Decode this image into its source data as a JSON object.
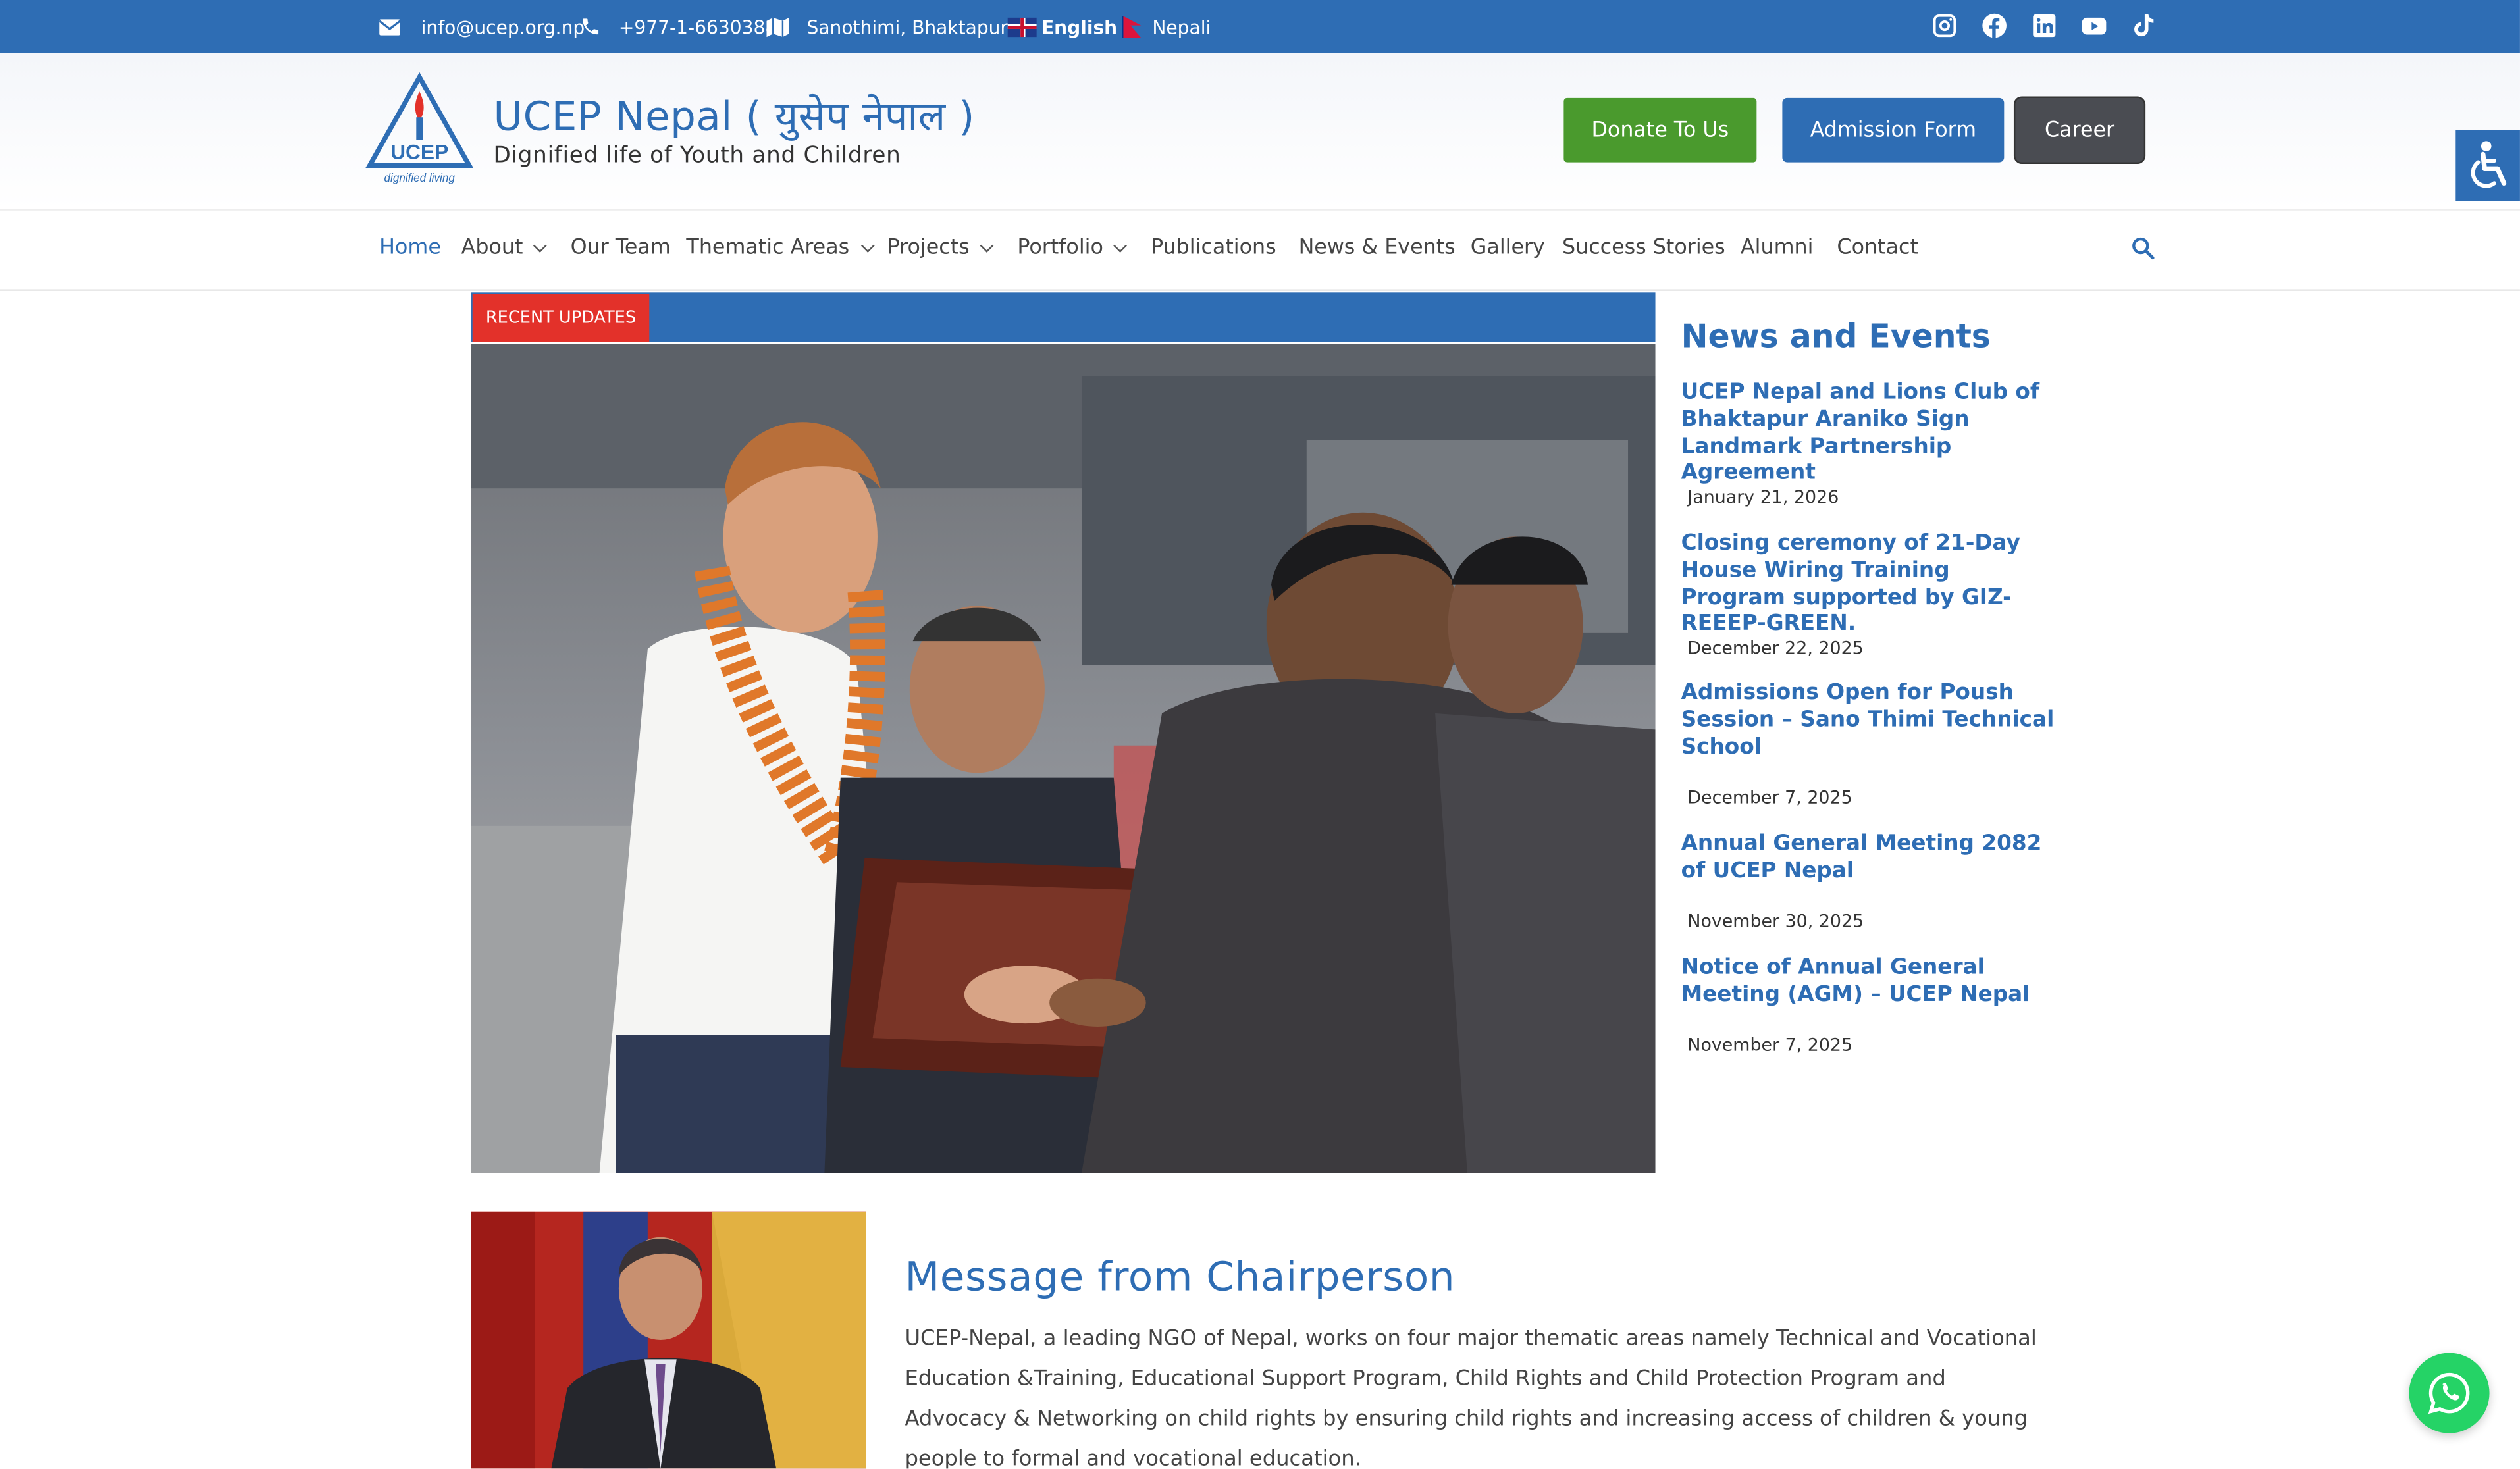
{
  "topbar": {
    "email": "info@ucep.org.np",
    "phone": "+977-1-6630388",
    "address": "Sanothimi, Bhaktapur",
    "lang_english": "English",
    "lang_nepali": "Nepali",
    "social": [
      "instagram-icon",
      "facebook-icon",
      "linkedin-icon",
      "youtube-icon",
      "tiktok-icon"
    ]
  },
  "header": {
    "title": "UCEP Nepal ( युसेप नेपाल )",
    "tagline": "Dignified life of Youth and Children",
    "logo_text": "UCEP",
    "logo_sub": "dignified living",
    "donate_label": "Donate To Us",
    "admission_label": "Admission Form",
    "career_label": "Career"
  },
  "nav": {
    "items": [
      "Home",
      "About",
      "Our Team",
      "Thematic Areas",
      "Projects",
      "Portfolio",
      "Publications",
      "News & Events",
      "Gallery",
      "Success Stories",
      "Alumni",
      "Contact"
    ]
  },
  "slider": {
    "badge": "RECENT UPDATES"
  },
  "news": {
    "title": "News and Events",
    "items": [
      {
        "title": "UCEP Nepal and Lions Club of Bhaktapur Araniko Sign Landmark Partnership Agreement",
        "date": "January 21, 2026"
      },
      {
        "title": "Closing ceremony of 21-Day House Wiring Training Program supported by GIZ-REEEP-GREEN.",
        "date": "December 22, 2025"
      },
      {
        "title": "Admissions Open for Poush Session – Sano Thimi Technical School",
        "date": "December 7, 2025"
      },
      {
        "title": "Annual General Meeting 2082 of UCEP Nepal",
        "date": "November 30, 2025"
      },
      {
        "title": "Notice of Annual General Meeting (AGM) – UCEP Nepal",
        "date": "November 7, 2025"
      }
    ]
  },
  "chair": {
    "title": "Message from Chairperson",
    "text": "UCEP-Nepal, a leading NGO of Nepal, works on four major thematic areas namely Technical and Vocational Education &Training, Educational Support Program, Child Rights and Child Protection Program and Advocacy & Networking on child rights by ensuring child rights and increasing access of children & young people to formal and vocational education."
  },
  "colors": {
    "primary": "#2e6db4",
    "donate": "#4a9a2d",
    "career": "#4a4c52",
    "badge": "#e3312a",
    "whatsapp": "#25d366"
  }
}
